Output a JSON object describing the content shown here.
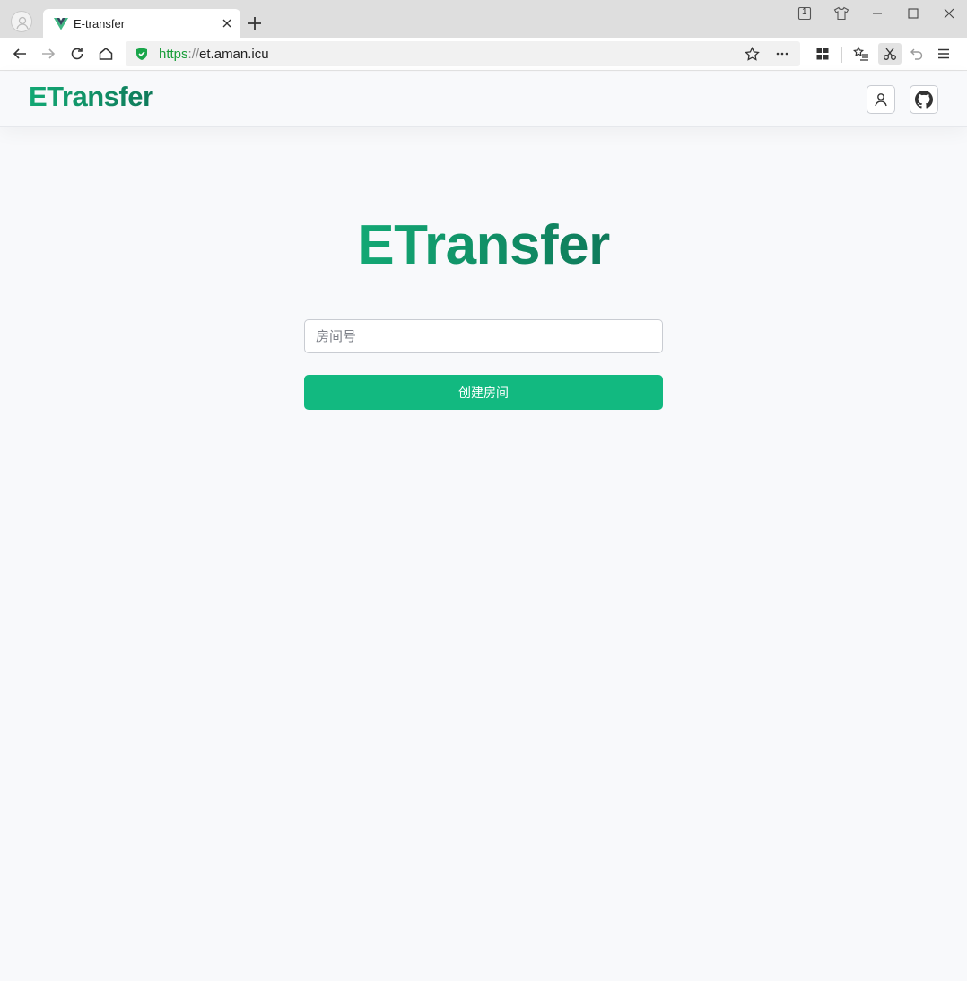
{
  "browser": {
    "tab": {
      "title": "E-transfer"
    },
    "address": {
      "scheme": "https",
      "separator": "://",
      "host": "et.aman.icu"
    },
    "tab_count_badge": "1"
  },
  "header": {
    "brand": "ETransfer"
  },
  "main": {
    "hero_title": "ETransfer",
    "room_input_placeholder": "房间号",
    "create_button_label": "创建房间"
  },
  "colors": {
    "brand": "#13a874",
    "button": "#12b980",
    "secure": "#1a9e3a"
  }
}
